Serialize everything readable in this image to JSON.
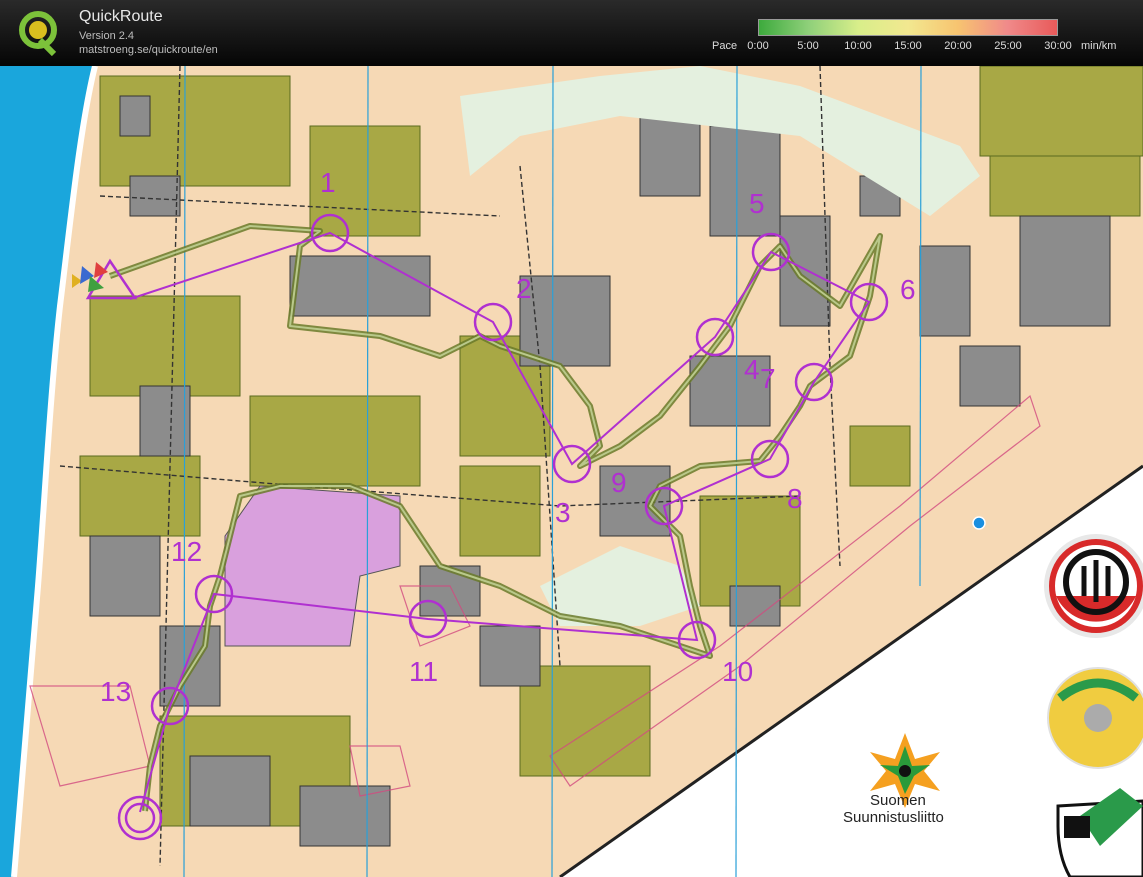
{
  "app": {
    "title": "QuickRoute",
    "version": "Version 2.4",
    "url": "matstroeng.se/quickroute/en",
    "logo_icon": "quickroute-q-logo-icon"
  },
  "pace_legend": {
    "label": "Pace",
    "ticks": [
      "0:00",
      "5:00",
      "10:00",
      "15:00",
      "20:00",
      "25:00",
      "30:00"
    ],
    "unit": "min/km",
    "colors": [
      "#3daa3d",
      "#8fd07a",
      "#d8ee8a",
      "#f2e890",
      "#f7c470",
      "#f08a8a",
      "#e85a5a"
    ]
  },
  "map": {
    "course_color": "#b030d0",
    "route_color": "#6a7a2a",
    "controls": [
      "1",
      "2",
      "3",
      "4",
      "5",
      "6",
      "7",
      "8",
      "9",
      "10",
      "11",
      "12",
      "13"
    ]
  },
  "sponsors": {
    "federation_name_line1": "Suomen",
    "federation_name_line2": "Suunnistusliitto",
    "club_logo_icon": "club-jus-logo-icon",
    "parma_logo_icon": "parma-logo-icon",
    "pr_logo_icon": "pr-logo-icon",
    "federation_logo_icon": "suomen-suunnistusliitto-star-icon"
  }
}
